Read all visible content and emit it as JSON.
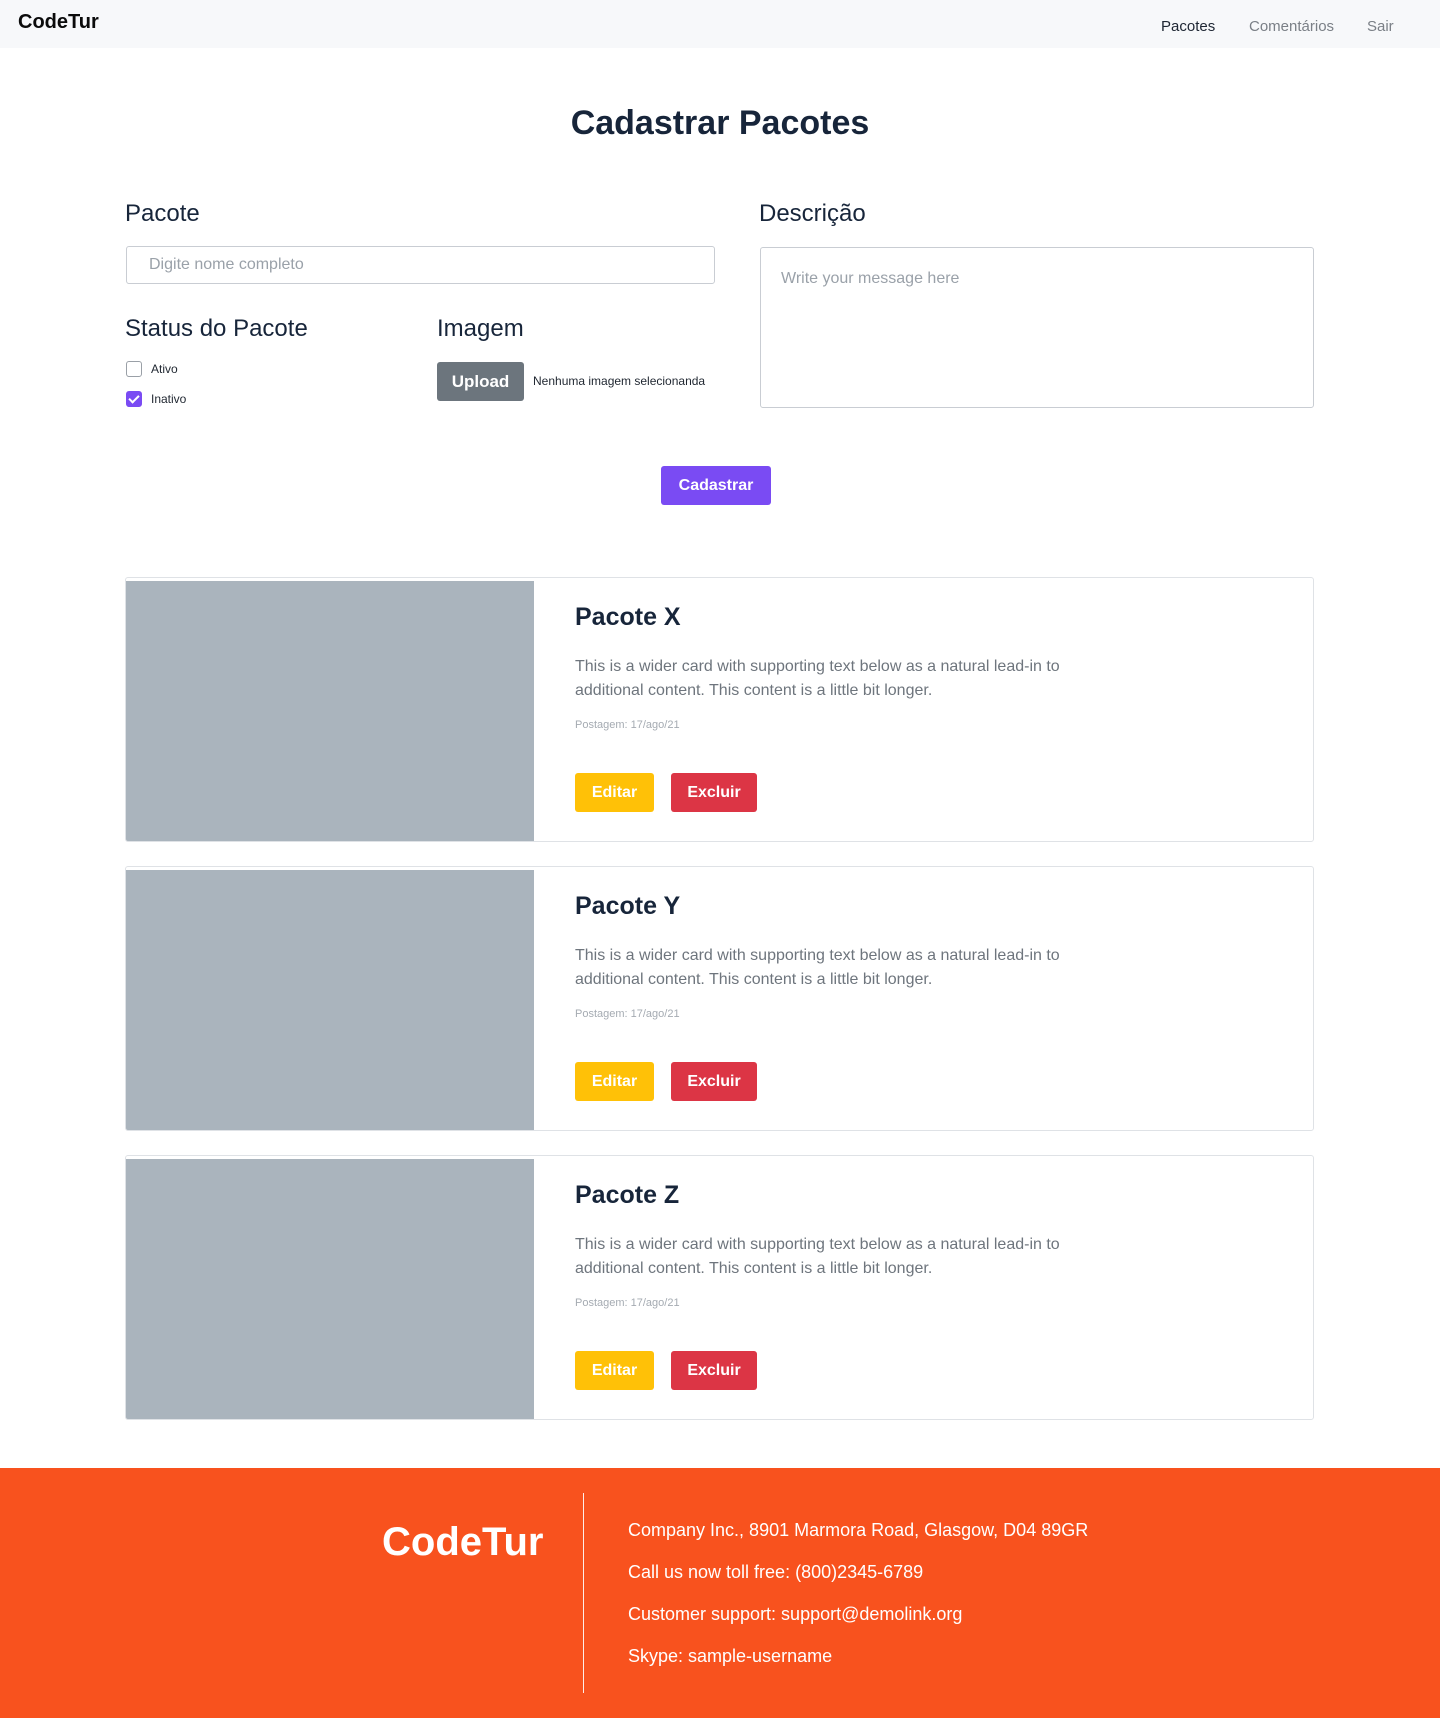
{
  "navbar": {
    "brand": "CodeTur",
    "links": [
      "Pacotes",
      "Comentários",
      "Sair"
    ]
  },
  "page": {
    "title": "Cadastrar Pacotes"
  },
  "form": {
    "pacote_label": "Pacote",
    "pacote_placeholder": "Digite nome completo",
    "descricao_label": "Descrição",
    "descricao_placeholder": "Write your message here",
    "status_label": "Status do Pacote",
    "status_options": [
      {
        "label": "Ativo",
        "checked": false
      },
      {
        "label": "Inativo",
        "checked": true
      }
    ],
    "imagem_label": "Imagem",
    "upload_label": "Upload",
    "upload_status": "Nenhuma imagem selecionanda",
    "submit_label": "Cadastrar"
  },
  "cards": [
    {
      "title": "Pacote X",
      "text": "This is a wider card with supporting text below as a natural lead-in to additional content. This content is a little bit longer.",
      "date": "Postagem: 17/ago/21",
      "edit_label": "Editar",
      "delete_label": "Excluir"
    },
    {
      "title": "Pacote Y",
      "text": "This is a wider card with supporting text below as a natural lead-in to additional content. This content is a little bit longer.",
      "date": "Postagem: 17/ago/21",
      "edit_label": "Editar",
      "delete_label": "Excluir"
    },
    {
      "title": "Pacote Z",
      "text": "This is a wider card with supporting text below as a natural lead-in to additional content. This content is a little bit longer.",
      "date": "Postagem: 17/ago/21",
      "edit_label": "Editar",
      "delete_label": "Excluir"
    }
  ],
  "footer": {
    "brand": "CodeTur",
    "lines": [
      "Company Inc., 8901 Marmora Road, Glasgow, D04 89GR",
      "Call us now toll free: (800)2345-6789",
      "Customer support: support@demolink.org",
      "Skype: sample-username"
    ]
  },
  "colors": {
    "accent": "#7a4bf3",
    "warning": "#ffc107",
    "danger": "#dc3545",
    "secondary": "#6c757d",
    "footer": "#f8521e",
    "image_placeholder": "#aab4bd"
  }
}
